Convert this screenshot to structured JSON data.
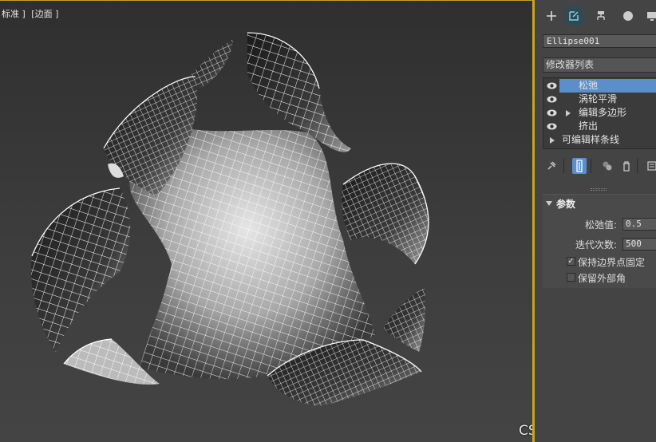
{
  "viewport": {
    "label_shading": "标准 ]",
    "label_edges": "[边面 ]",
    "watermark": "CSDN @沐风老师",
    "colors": {
      "background_top": "#2f2f2f",
      "background_bottom": "#444444",
      "wire": "#ffffff",
      "active_border": "#c9a227"
    }
  },
  "panel": {
    "tabs": [
      {
        "icon": "plus-icon",
        "active": false
      },
      {
        "icon": "modify-icon",
        "active": true
      },
      {
        "icon": "hierarchy-icon",
        "active": false
      },
      {
        "icon": "motion-icon",
        "active": false
      },
      {
        "icon": "display-icon",
        "active": false
      }
    ],
    "object_name": "Ellipse001",
    "modifier_list_label": "修改器列表",
    "stack": [
      {
        "label": "松弛",
        "selected": true,
        "has_eye": true,
        "expandable": false
      },
      {
        "label": "涡轮平滑",
        "selected": false,
        "has_eye": true,
        "expandable": false
      },
      {
        "label": "编辑多边形",
        "selected": false,
        "has_eye": true,
        "expandable": true
      },
      {
        "label": "挤出",
        "selected": false,
        "has_eye": true,
        "expandable": false
      },
      {
        "label": "可编辑样条线",
        "selected": false,
        "has_eye": false,
        "expandable": true
      }
    ],
    "tools": [
      "pin-stack-icon",
      "show-end-result-icon",
      "make-unique-icon",
      "remove-modifier-icon",
      "configure-sets-icon"
    ],
    "rollout": {
      "title": "参数",
      "relax_value_label": "松弛值:",
      "relax_value": "0.5",
      "iterations_label": "迭代次数:",
      "iterations": "500",
      "keep_boundary_label": "保持边界点固定",
      "keep_boundary_checked": true,
      "save_outer_corners_label": "保留外部角",
      "save_outer_corners_checked": false
    },
    "colors": {
      "panel_bg": "#444444",
      "selection": "#5b8fcc"
    }
  }
}
